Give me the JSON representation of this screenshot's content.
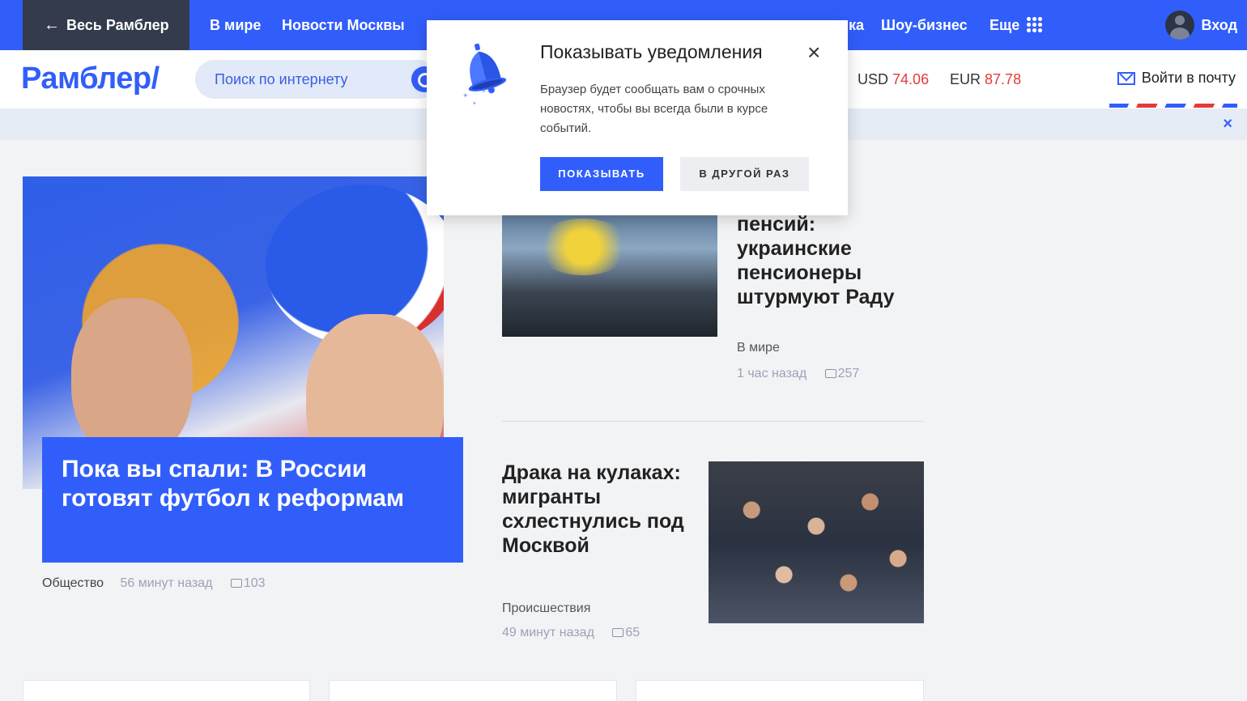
{
  "topnav": {
    "back_label": "Весь Рамблер",
    "links": [
      "В мире",
      "Новости Москвы",
      "ка",
      "Шоу-бизнес"
    ],
    "more_label": "Еще",
    "login_label": "Вход"
  },
  "header": {
    "logo": "Рамблер/",
    "search_placeholder": "Поиск по интернету",
    "usd_label": "USD",
    "usd_value": "74.06",
    "eur_label": "EUR",
    "eur_value": "87.78",
    "mail_label": "Войти в почту",
    "close_glyph": "×"
  },
  "popup": {
    "title": "Показывать уведомления",
    "text": "Браузер будет сообщать вам о срочных новостях, чтобы вы всегда были в курсе событий.",
    "primary_label": "ПОКАЗЫВАТЬ",
    "secondary_label": "В ДРУГОЙ РАЗ",
    "close_glyph": "×"
  },
  "main_article": {
    "title": "Пока вы спали: В России готовят футбол к реформам",
    "category": "Общество",
    "time": "56 минут назад",
    "comments": "103"
  },
  "articles": [
    {
      "title": "пенсий: украинские пенсионеры штурмуют Раду",
      "category": "В мире",
      "time": "1 час назад",
      "comments": "257"
    },
    {
      "title": "Драка на кулаках: мигранты схлестнулись под Москвой",
      "category": "Происшествия",
      "time": "49 минут назад",
      "comments": "65"
    }
  ],
  "colors": {
    "brand": "#315efb",
    "accent_red": "#e53a3a",
    "dark_nav": "#343b4c"
  }
}
